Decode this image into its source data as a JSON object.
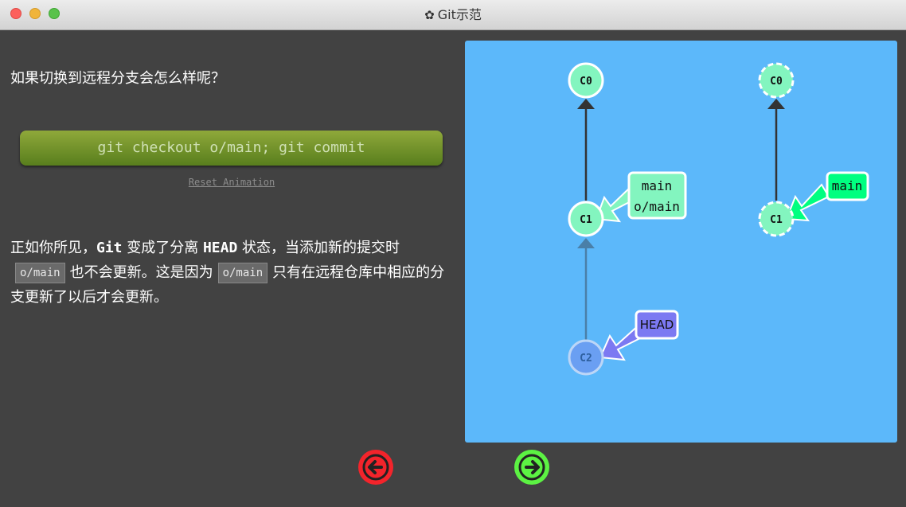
{
  "window": {
    "title": "Git示范",
    "icon": "gear-icon"
  },
  "left_panel": {
    "question": "如果切换到远程分支会怎么样呢？",
    "command_button": "git checkout o/main; git commit",
    "reset_link": "Reset Animation",
    "description": {
      "part1": "正如你所见，",
      "git": "Git",
      "part2": " 变成了分离 ",
      "head": "HEAD",
      "part3": " 状态，当添加新的提交时",
      "code1": "o/main",
      "part4": "也不会更新。这是因为",
      "code2": "o/main",
      "part5": "只有在远程仓库中相应的分支更新了以后才会更新。"
    }
  },
  "graph": {
    "local": {
      "commits": [
        "C0",
        "C1",
        "C2"
      ],
      "branch_label_line1": "main",
      "branch_label_line2": "o/main",
      "head_label": "HEAD"
    },
    "remote": {
      "commits": [
        "C0",
        "C1"
      ],
      "branch_label": "main"
    }
  },
  "colors": {
    "canvas_bg": "#5cb8fa",
    "commit": "#83f5bf",
    "commit_detached": "#6a9ff2",
    "branch_label": "#83f5bf",
    "head_label": "#7c79f2",
    "remote_branch": "#00ff80",
    "nav_back": "#f3242b",
    "nav_forward": "#5cf243"
  },
  "nav": {
    "back_icon": "arrow-left-icon",
    "forward_icon": "arrow-right-icon"
  }
}
